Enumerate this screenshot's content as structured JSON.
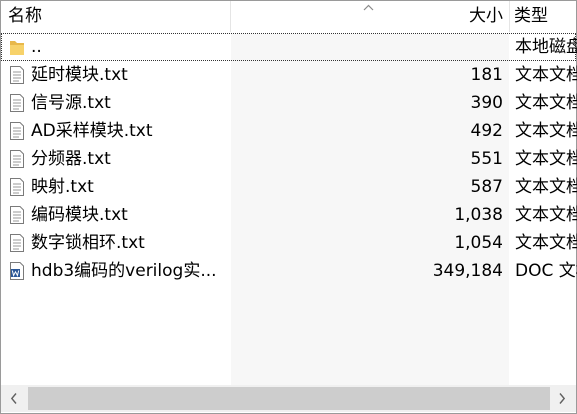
{
  "header": {
    "name": "名称",
    "size": "大小",
    "type": "类型"
  },
  "rows": [
    {
      "icon": "folder-icon",
      "name": "..",
      "size": "",
      "type": "本地磁盘"
    },
    {
      "icon": "text-file-icon",
      "name": "延时模块.txt",
      "size": "181",
      "type": "文本文档"
    },
    {
      "icon": "text-file-icon",
      "name": "信号源.txt",
      "size": "390",
      "type": "文本文档"
    },
    {
      "icon": "text-file-icon",
      "name": "AD采样模块.txt",
      "size": "492",
      "type": "文本文档"
    },
    {
      "icon": "text-file-icon",
      "name": "分频器.txt",
      "size": "551",
      "type": "文本文档"
    },
    {
      "icon": "text-file-icon",
      "name": "映射.txt",
      "size": "587",
      "type": "文本文档"
    },
    {
      "icon": "text-file-icon",
      "name": "编码模块.txt",
      "size": "1,038",
      "type": "文本文档"
    },
    {
      "icon": "text-file-icon",
      "name": "数字锁相环.txt",
      "size": "1,054",
      "type": "文本文档"
    },
    {
      "icon": "word-doc-icon",
      "name": "hdb3编码的verilog实...",
      "size": "349,184",
      "type": "DOC 文档"
    }
  ],
  "colors": {
    "sorted_column_bg": "#f7f7f7",
    "scrollbar_thumb": "#cdcdcd",
    "word_blue": "#2b5797"
  }
}
